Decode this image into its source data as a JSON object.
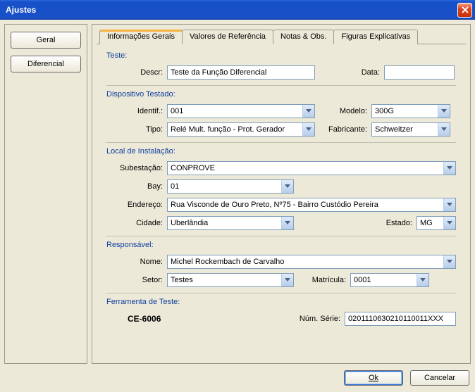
{
  "window": {
    "title": "Ajustes"
  },
  "sidebar": {
    "geral": "Geral",
    "diferencial": "Diferencial"
  },
  "tabs": {
    "t0": "Informações Gerais",
    "t1": "Valores de Referência",
    "t2": "Notas & Obs.",
    "t3": "Figuras Explicativas"
  },
  "grp_teste": {
    "title": "Teste:",
    "descr_label": "Descr:",
    "descr_value": "Teste da Função Diferencial",
    "data_label": "Data:",
    "data_value": ""
  },
  "grp_disp": {
    "title": "Dispositivo Testado:",
    "identif_label": "Identif.:",
    "identif_value": "001",
    "modelo_label": "Modelo:",
    "modelo_value": "300G",
    "tipo_label": "Tipo:",
    "tipo_value": "Relé Mult. função - Prot. Gerador",
    "fabricante_label": "Fabricante:",
    "fabricante_value": "Schweitzer"
  },
  "grp_local": {
    "title": "Local de Instalação:",
    "subestacao_label": "Subestação:",
    "subestacao_value": "CONPROVE",
    "bay_label": "Bay:",
    "bay_value": "01",
    "endereco_label": "Endereço:",
    "endereco_value": "Rua Visconde de Ouro Preto, Nº75 - Bairro Custódio Pereira",
    "cidade_label": "Cidade:",
    "cidade_value": "Uberlândia",
    "estado_label": "Estado:",
    "estado_value": "MG"
  },
  "grp_resp": {
    "title": "Responsável:",
    "nome_label": "Nome:",
    "nome_value": "Michel Rockembach de Carvalho",
    "setor_label": "Setor:",
    "setor_value": "Testes",
    "matricula_label": "Matrícula:",
    "matricula_value": "0001"
  },
  "grp_ferr": {
    "title": "Ferramenta de Teste:",
    "name": "CE-6006",
    "serie_label": "Núm. Série:",
    "serie_value": "0201110630210110011XXX"
  },
  "footer": {
    "ok": "Ok",
    "cancel": "Cancelar"
  }
}
